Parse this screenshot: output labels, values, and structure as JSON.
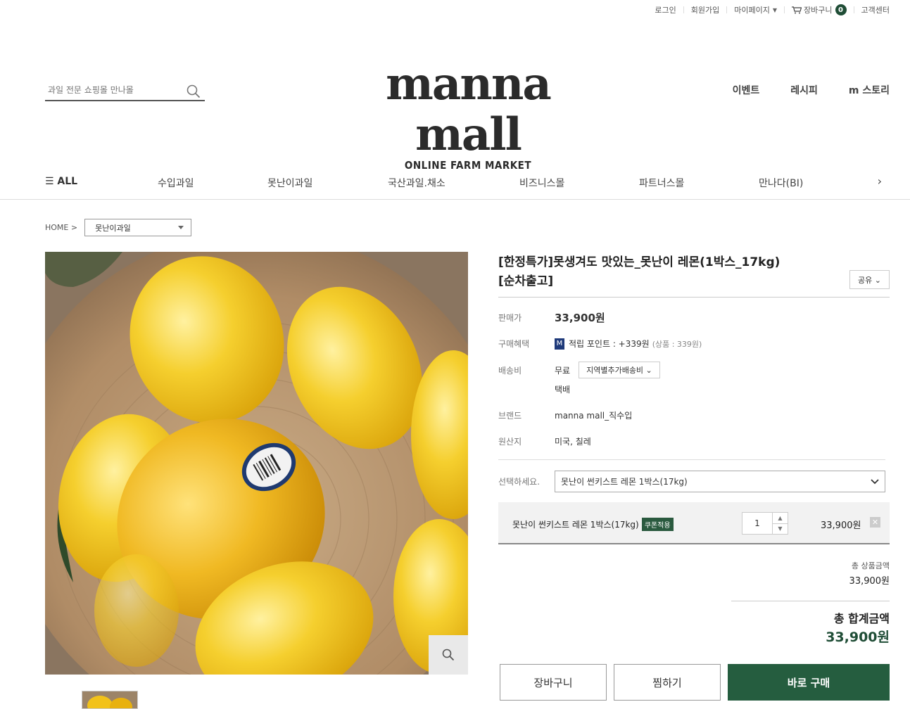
{
  "util_nav": {
    "login": "로그인",
    "signup": "회원가입",
    "mypage": "마이페이지",
    "cart": "장바구니",
    "cart_count": "0",
    "support": "고객센터"
  },
  "search": {
    "placeholder": "과일 전문 쇼핑몰 만나몰"
  },
  "logo": {
    "brand": "manna mall",
    "tagline": "ONLINE FARM MARKET"
  },
  "header_nav": [
    "이벤트",
    "레시피",
    "m 스토리"
  ],
  "gnb": {
    "all": "☰ ALL",
    "items": [
      "수입과일",
      "못난이과일",
      "국산과일.채소",
      "비즈니스몰",
      "파트너스몰",
      "만나다(BI)"
    ]
  },
  "breadcrumb": {
    "home": "HOME >",
    "category": "못난이과일"
  },
  "product": {
    "title": "[한정특가]못생겨도 맛있는_못난이 레몬(1박스_17kg)[순차출고]",
    "share": "공유 ⌄",
    "price_label": "판매가",
    "price": "33,900원",
    "benefit_label": "구매혜택",
    "benefit_badge": "M",
    "benefit_text": "적립 포인트 : +339원",
    "benefit_sub": "(상품 : 339원)",
    "shipping_label": "배송비",
    "shipping_value": "무료",
    "shipping_select": "지역별추가배송비 ⌄",
    "shipping_method": "택배",
    "brand_label": "브랜드",
    "brand_value": "manna mall_직수입",
    "origin_label": "원산지",
    "origin_value": "미국, 칠레",
    "option_label": "선택하세요.",
    "option_value": "못난이 썬키스트 레몬 1박스(17kg)"
  },
  "selected": {
    "name": "못난이 썬키스트 레몬 1박스(17kg)",
    "coupon": "쿠폰적용",
    "qty": "1",
    "price": "33,900원"
  },
  "summary": {
    "subtotal_label": "총 상품금액",
    "subtotal": "33,900원",
    "total_label": "총 합계금액",
    "total": "33,900원"
  },
  "buttons": {
    "cart": "장바구니",
    "wish": "찜하기",
    "buy": "바로 구매"
  },
  "colors": {
    "accent": "#255d3f",
    "lemon": "#f2c21a"
  }
}
